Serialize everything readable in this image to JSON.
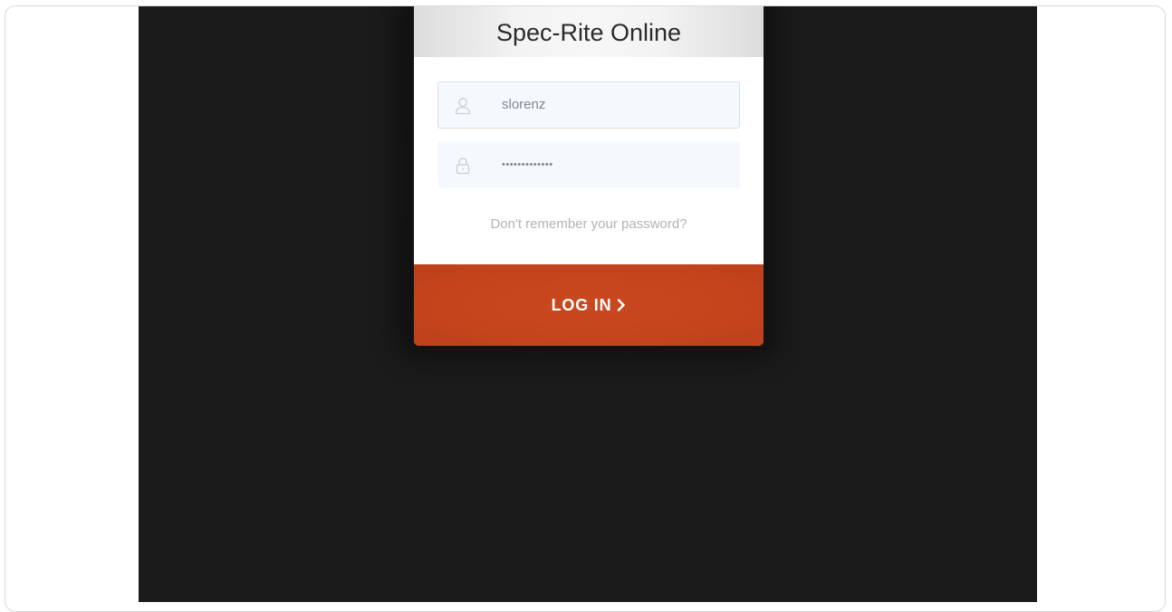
{
  "app": {
    "title": "Spec-Rite Online"
  },
  "login_form": {
    "username": {
      "value": "slorenz",
      "icon": "user-icon"
    },
    "password": {
      "masked_value": "•••••••••••••",
      "icon": "lock-icon"
    },
    "forgot_password_label": "Don't remember your password?",
    "submit_label": "LOG IN",
    "submit_icon": "chevron-right-icon"
  },
  "colors": {
    "background": "#1b1b1b",
    "accent": "#c4441c",
    "field_background": "#f5f8fc"
  }
}
